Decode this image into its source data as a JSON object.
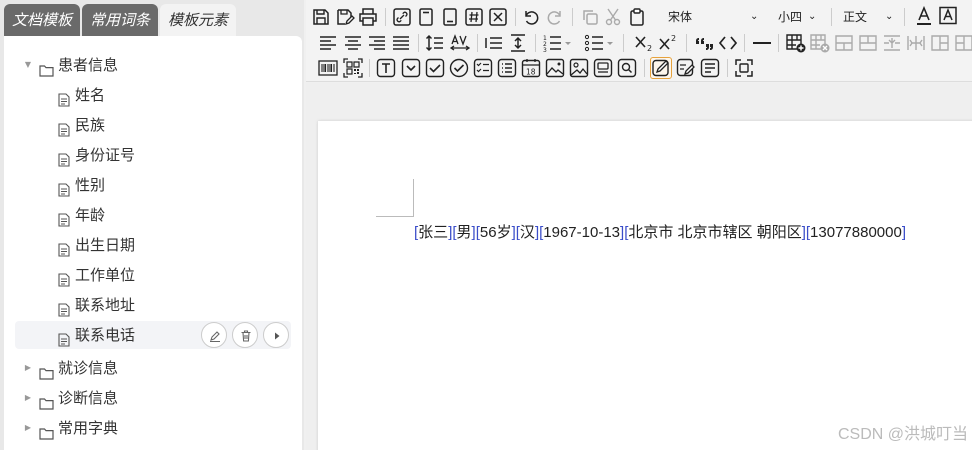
{
  "tabs": [
    "文档模板",
    "常用词条",
    "模板元素"
  ],
  "tree": {
    "groups": [
      "患者信息",
      "就诊信息",
      "诊断信息",
      "常用字典"
    ],
    "patient_items": [
      "姓名",
      "民族",
      "身份证号",
      "性别",
      "年龄",
      "出生日期",
      "工作单位",
      "联系地址",
      "联系电话"
    ]
  },
  "toolbar": {
    "font_name": "宋体",
    "font_size": "小四",
    "paragraph_style": "正文"
  },
  "document": {
    "fields": [
      "张三",
      "男",
      "56岁",
      "汉",
      "1967-10-13",
      "北京市 北京市辖区 朝阳区",
      "13077880000"
    ]
  },
  "watermark": "CSDN @洪城叮当",
  "colors": {
    "accent": "#3a4dc9",
    "tab_dark": "#6a6a6a",
    "highlight_border": "#e6a23c"
  }
}
